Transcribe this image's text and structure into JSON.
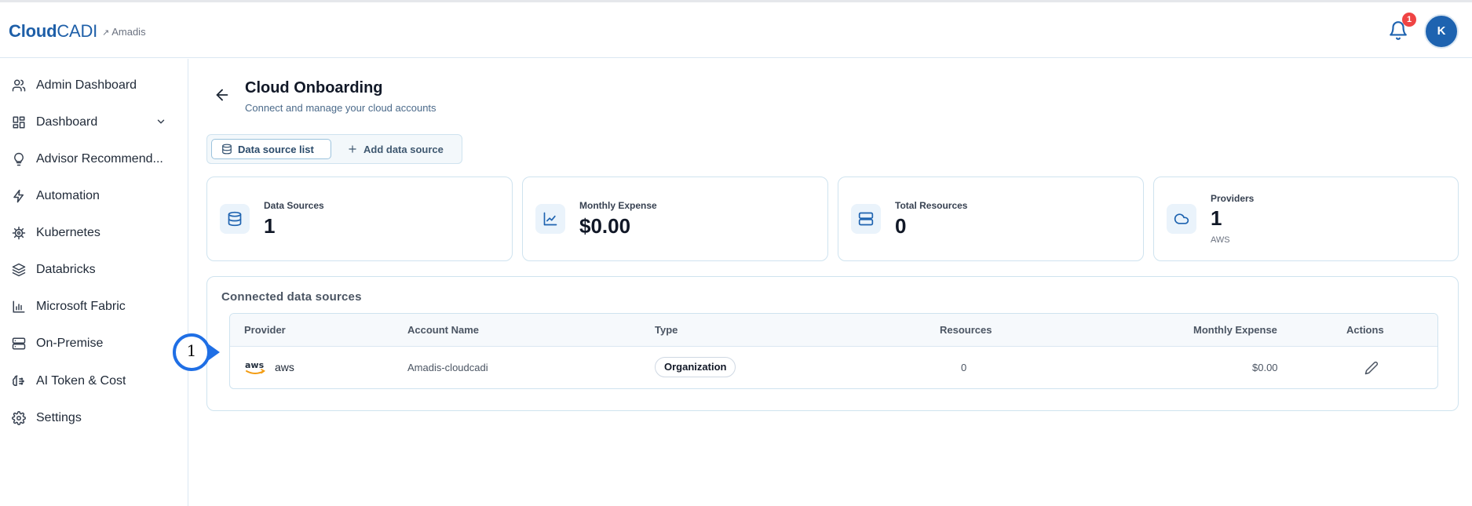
{
  "header": {
    "logo_bold": "Cloud",
    "logo_light": "CADI",
    "tenant": "Amadis",
    "notification_count": "1",
    "avatar_initial": "K"
  },
  "sidebar": {
    "items": [
      {
        "label": "Admin Dashboard",
        "icon": "users-icon"
      },
      {
        "label": "Dashboard",
        "icon": "dashboard-grid-icon"
      },
      {
        "label": "Advisor Recommend...",
        "icon": "lightbulb-icon"
      },
      {
        "label": "Automation",
        "icon": "bolt-icon"
      },
      {
        "label": "Kubernetes",
        "icon": "helm-wheel-icon"
      },
      {
        "label": "Databricks",
        "icon": "layers-icon"
      },
      {
        "label": "Microsoft Fabric",
        "icon": "bar-chart-icon"
      },
      {
        "label": "On-Premise",
        "icon": "server-icon"
      },
      {
        "label": "AI Token & Cost",
        "icon": "brain-icon"
      },
      {
        "label": "Settings",
        "icon": "gear-icon"
      }
    ]
  },
  "page": {
    "title": "Cloud Onboarding",
    "subtitle": "Connect and manage your cloud accounts"
  },
  "tabs": {
    "list_label": "Data source list",
    "add_label": "Add data source"
  },
  "stats": [
    {
      "label": "Data Sources",
      "value": "1",
      "sub": ""
    },
    {
      "label": "Monthly Expense",
      "value": "$0.00",
      "sub": ""
    },
    {
      "label": "Total Resources",
      "value": "0",
      "sub": ""
    },
    {
      "label": "Providers",
      "value": "1",
      "sub": "AWS"
    }
  ],
  "connected": {
    "title": "Connected data sources",
    "columns": {
      "provider": "Provider",
      "account": "Account Name",
      "type": "Type",
      "resources": "Resources",
      "expense": "Monthly Expense",
      "actions": "Actions"
    },
    "rows": [
      {
        "provider_logo": "aws",
        "provider": "aws",
        "account": "Amadis-cloudcadi",
        "type": "Organization",
        "resources": "0",
        "expense": "$0.00"
      }
    ]
  },
  "annotation": {
    "marker_number": "1"
  },
  "colors": {
    "brand": "#1e5fa8",
    "accent_blue": "#1f6fe5",
    "badge_red": "#ef4444",
    "border": "#cfe3ef"
  }
}
